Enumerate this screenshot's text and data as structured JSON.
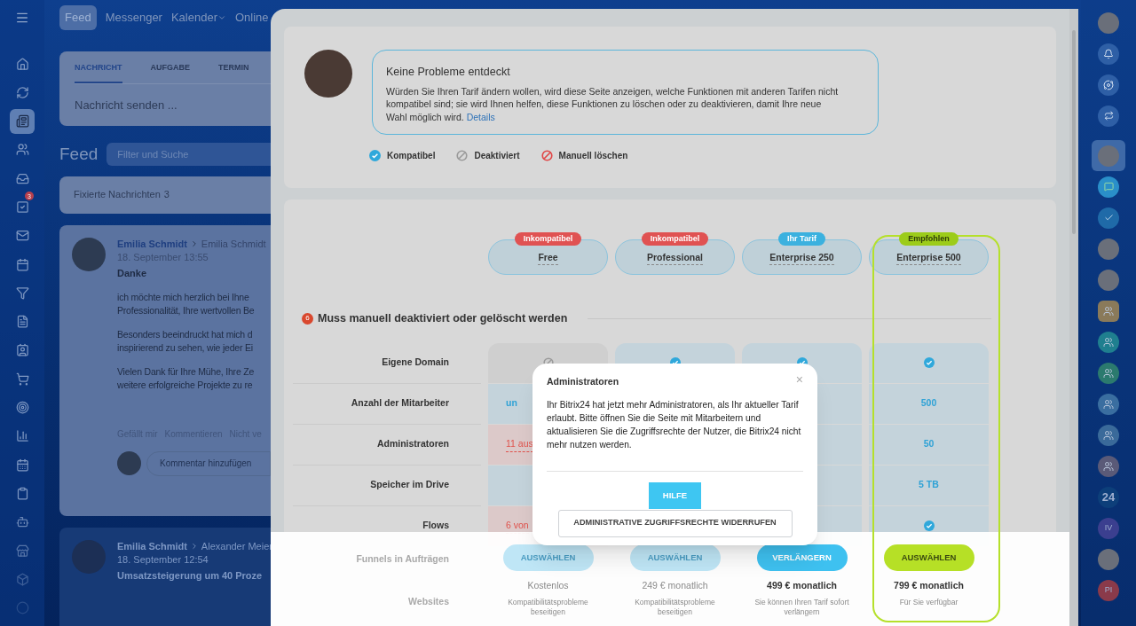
{
  "top_nav": {
    "items": [
      {
        "label": "Feed",
        "selected": true,
        "dropdown": false
      },
      {
        "label": "Messenger",
        "selected": false,
        "dropdown": false
      },
      {
        "label": "Kalender",
        "selected": false,
        "dropdown": true
      },
      {
        "label": "Online",
        "selected": false,
        "dropdown": false
      }
    ]
  },
  "left_sidebar": {
    "items": [
      {
        "kind": "home",
        "selected": false
      },
      {
        "kind": "sync",
        "selected": false
      },
      {
        "kind": "feed",
        "selected": true
      },
      {
        "kind": "people",
        "selected": false
      },
      {
        "kind": "inbox",
        "selected": false
      },
      {
        "kind": "tasks",
        "selected": false,
        "badge": "3"
      },
      {
        "kind": "mail",
        "selected": false
      },
      {
        "kind": "calendar",
        "selected": false
      },
      {
        "kind": "funnel",
        "selected": false
      },
      {
        "kind": "document",
        "selected": false
      },
      {
        "kind": "contact",
        "selected": false
      },
      {
        "kind": "cart",
        "selected": false
      },
      {
        "kind": "target",
        "selected": false
      },
      {
        "kind": "chart",
        "selected": false
      },
      {
        "kind": "schedule",
        "selected": false
      },
      {
        "kind": "clipboard",
        "selected": false
      },
      {
        "kind": "robot",
        "selected": false
      },
      {
        "kind": "store",
        "selected": false
      },
      {
        "kind": "box",
        "selected": false
      },
      {
        "kind": "circle",
        "selected": false
      }
    ]
  },
  "composer": {
    "tabs": [
      {
        "label": "NACHRICHT",
        "selected": true
      },
      {
        "label": "AUFGABE",
        "selected": false
      },
      {
        "label": "TERMIN",
        "selected": false
      }
    ],
    "placeholder": "Nachricht senden ..."
  },
  "feed": {
    "title": "Feed",
    "filter_placeholder": "Filter und Suche",
    "pinned": {
      "label": "Fixierte Nachrichten",
      "count": "3"
    }
  },
  "posts": [
    {
      "author": "Emilia Schmidt",
      "recipient": "Emilia Schmidt",
      "time": "18. September 13:55",
      "title": "Danke",
      "paragraphs": [
        [
          "ich möchte mich herzlich bei Ihne",
          "Professionalität, Ihre wertvollen Be"
        ],
        [
          "Besonders beeindruckt hat mich d",
          "inspirierend zu sehen, wie jeder Ei"
        ],
        [
          "Vielen Dank für Ihre Mühe, Ihre Ze",
          "weitere erfolgreiche Projekte zu re"
        ]
      ],
      "actions": [
        "Gefällt mir",
        "Kommentieren",
        "Nicht ve"
      ],
      "comment_placeholder": "Kommentar hinzufügen"
    },
    {
      "author": "Emilia Schmidt",
      "recipient": "Alexander Meier",
      "time": "18. September 12:54",
      "title": "Umsatzsteigerung um 40 Proze"
    }
  ],
  "right_sidebar": {
    "items": [
      {
        "kind": "photo"
      },
      {
        "kind": "bell"
      },
      {
        "kind": "spiral"
      },
      {
        "kind": "exchange"
      },
      {
        "kind": "photo",
        "selected": true
      },
      {
        "kind": "chat",
        "color": "#2a8fc9"
      },
      {
        "kind": "check",
        "color": "#1f6aa8"
      },
      {
        "kind": "photo"
      },
      {
        "kind": "photo"
      },
      {
        "kind": "group",
        "color": "#8a7a5a"
      },
      {
        "kind": "group",
        "color": "#1f7f8f"
      },
      {
        "kind": "group",
        "color": "#2b7a6e"
      },
      {
        "kind": "group",
        "color": "#3a6ea0"
      },
      {
        "kind": "group",
        "color": "#3a6a9a"
      },
      {
        "kind": "group",
        "color": "#5a5a78"
      },
      {
        "kind": "text",
        "text": "24",
        "color": "#0d3f7a"
      },
      {
        "kind": "text",
        "text": "IV",
        "color": "#3b3f8f"
      },
      {
        "kind": "photo"
      },
      {
        "kind": "text",
        "text": "PI",
        "color": "#8a3a4a"
      }
    ]
  },
  "intro": {
    "title": "Keine Probleme entdeckt",
    "text": "Würden Sie Ihren Tarif ändern wollen, wird diese Seite anzeigen, welche Funktionen mit anderen Tarifen nicht kompatibel sind; sie wird Ihnen helfen, diese Funktionen zu löschen oder zu deaktivieren, damit Ihre neue Wahl möglich wird.",
    "link": "Details"
  },
  "legend": [
    {
      "kind": "check",
      "label": "Kompatibel"
    },
    {
      "kind": "deactivated",
      "label": "Deaktiviert"
    },
    {
      "kind": "delete",
      "label": "Manuell löschen"
    }
  ],
  "plans": [
    {
      "name": "Free",
      "badge": {
        "text": "Inkompatibel",
        "color": "#e05252"
      },
      "highlighted": false,
      "button": {
        "label": "AUSWÄHLEN",
        "kind": "disabled"
      },
      "price": "Kostenlos",
      "note": "Kompatibilitätsprobleme beseitigen"
    },
    {
      "name": "Professional",
      "badge": {
        "text": "Inkompatibel",
        "color": "#e05252"
      },
      "highlighted": false,
      "button": {
        "label": "AUSWÄHLEN",
        "kind": "disabled"
      },
      "price": "249 € monatlich",
      "note": "Kompatibilitätsprobleme beseitigen"
    },
    {
      "name": "Enterprise 250",
      "badge": {
        "text": "Ihr Tarif",
        "color": "#3bb1df"
      },
      "highlighted": false,
      "button": {
        "label": "VERLÄNGERN",
        "kind": "renew"
      },
      "price": "499 € monatlich",
      "note": "Sie können Ihren Tarif sofort verlängern"
    },
    {
      "name": "Enterprise 500",
      "badge": {
        "text": "Empfohlen",
        "color": "#9ccc1a"
      },
      "highlighted": true,
      "button": {
        "label": "AUSWÄHLEN",
        "kind": "recommended"
      },
      "price": "799 € monatlich",
      "note": "Für Sie verfügbar"
    }
  ],
  "section": {
    "count": "6",
    "title": "Muss manuell deaktiviert oder gelöscht werden"
  },
  "rows": [
    {
      "label": "Eigene Domain",
      "cells": [
        {
          "kind": "deactivated"
        },
        {
          "kind": "check"
        },
        {
          "kind": "check"
        },
        {
          "kind": "check"
        }
      ]
    },
    {
      "label": "Anzahl der Mitarbeiter",
      "cells": [
        {
          "kind": "value",
          "text": "un",
          "clipped": true
        },
        {
          "kind": "covered"
        },
        {
          "kind": "covered"
        },
        {
          "kind": "value",
          "text": "500",
          "clipped": false
        }
      ]
    },
    {
      "label": "Administratoren",
      "cells": [
        {
          "kind": "conflict",
          "text": "11 aus",
          "clipped": true
        },
        {
          "kind": "covered"
        },
        {
          "kind": "covered"
        },
        {
          "kind": "value",
          "text": "50",
          "clipped": false
        }
      ]
    },
    {
      "label": "Speicher im Drive",
      "cells": [
        {
          "kind": "covered"
        },
        {
          "kind": "covered"
        },
        {
          "kind": "covered"
        },
        {
          "kind": "value",
          "text": "5 TB",
          "clipped": false
        }
      ]
    },
    {
      "label": "Flows",
      "cells": [
        {
          "kind": "conflict",
          "text": "6 von",
          "clipped": true
        },
        {
          "kind": "covered"
        },
        {
          "kind": "covered"
        },
        {
          "kind": "check"
        }
      ]
    }
  ],
  "hidden_rows": [
    "Funnels in Aufträgen",
    "Websites"
  ],
  "dialog": {
    "title": "Administratoren",
    "close": "×",
    "text": "Ihr Bitrix24 hat jetzt mehr Administratoren, als Ihr aktueller Tarif erlaubt. Bitte öffnen Sie die Seite mit Mitarbeitern und aktualisieren Sie die Zugriffsrechte der Nutzer, die Bitrix24 nicht mehr nutzen werden.",
    "buttons": [
      {
        "label": "HILFE",
        "kind": "primary"
      },
      {
        "label": "ADMINISTRATIVE ZUGRIFFSRECHTE WIDERRUFEN",
        "kind": "secondary"
      }
    ]
  }
}
